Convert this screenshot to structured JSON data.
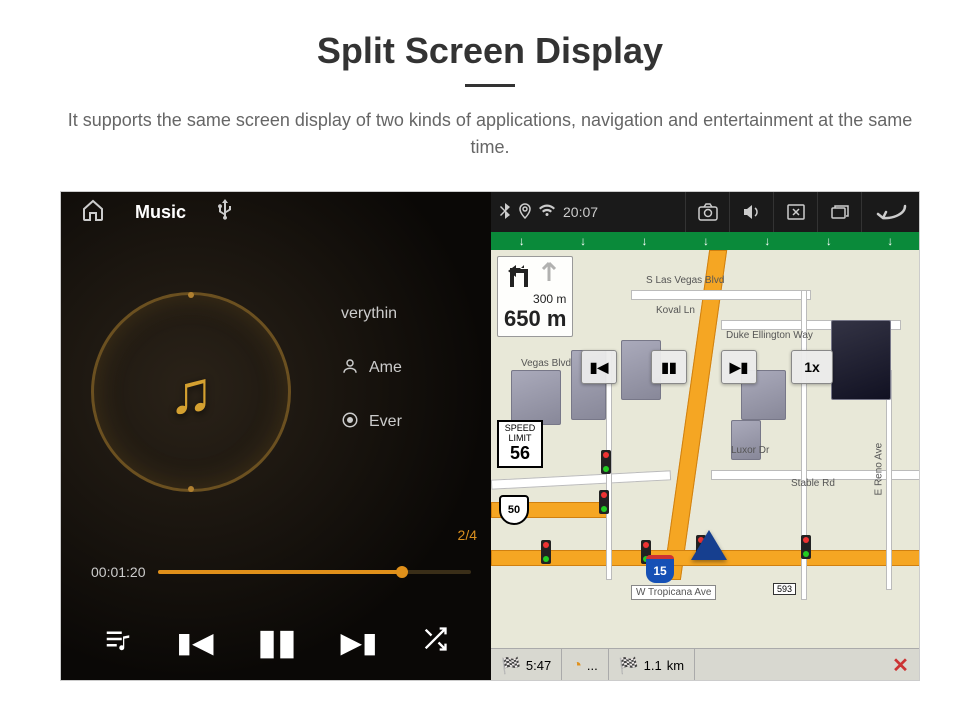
{
  "page": {
    "title": "Split Screen Display",
    "description": "It supports the same screen display of two kinds of applications, navigation and entertainment at the same time."
  },
  "music": {
    "topbar": {
      "label": "Music"
    },
    "tracks": {
      "title": "verythin",
      "artist": "Ame",
      "album": "Ever"
    },
    "counter": "2/4",
    "time_current": "00:01:20"
  },
  "nav": {
    "status": {
      "time": "20:07"
    },
    "turn": {
      "dist1": "300 m",
      "dist2": "650 m"
    },
    "speed_limit": {
      "label1": "SPEED",
      "label2": "LIMIT",
      "value": "56"
    },
    "shields": {
      "i15": "15",
      "us": "50",
      "exit": "593"
    },
    "streets": {
      "slv": "S Las Vegas Blvd",
      "koval": "Koval Ln",
      "duke": "Duke Ellington Way",
      "vegas_blvd": "Vegas Blvd",
      "luxor": "Luxor Dr",
      "stable": "Stable Rd",
      "reno": "E Reno Ave",
      "tropicana": "W Tropicana Ave"
    },
    "sim": {
      "speed": "1x"
    },
    "bottom": {
      "eta": "5:47",
      "time1": "...",
      "dist": "1.1",
      "dist_unit": "km"
    }
  }
}
